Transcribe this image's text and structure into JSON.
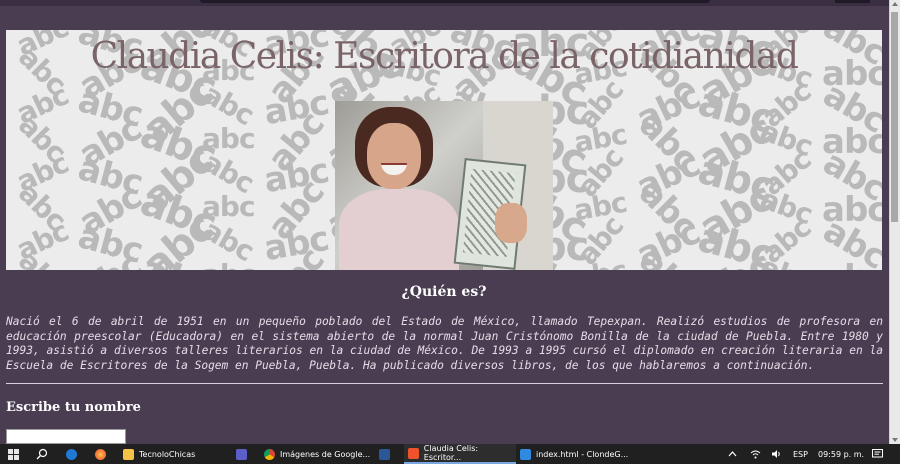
{
  "page": {
    "title": "Claudia Celis: Escritora de la cotidianidad",
    "banner_pattern_text": "abc",
    "section_title": "¿Quién es?",
    "bio": "Nació el 6 de abril de 1951 en un pequeño poblado del Estado de México, llamado Tepexpan. Realizó estudios de profesora en educación preescolar (Educadora) en el sistema abierto de la normal Juan Cristónomo Bonilla de la ciudad de Puebla. Entre 1980 y 1993, asistió a diversos talleres literarios en la ciudad de México. De 1993 a 1995 cursó el diplomado en creación literaria en la Escuela de Escritores de la Sogem en Puebla, Puebla. Ha publicado diversos libros, de los que hablaremos a continuación.",
    "name_label": "Escribe tu nombre",
    "name_value": ""
  },
  "taskbar": {
    "items": [
      {
        "label": "TecnoloChicas",
        "icon": "folder-icon"
      },
      {
        "label": "Imágenes de Google...",
        "icon": "chrome-icon"
      },
      {
        "label": "Claudia Celis: Escritor...",
        "icon": "brave-icon"
      },
      {
        "label": "index.html - ClondeG...",
        "icon": "vscode-icon"
      }
    ],
    "language": "ESP",
    "time": "09:59 p. m."
  },
  "colors": {
    "page_bg": "#4a3d52",
    "title": "#7a6468",
    "text": "#e4dde7",
    "taskbar": "#202020"
  }
}
